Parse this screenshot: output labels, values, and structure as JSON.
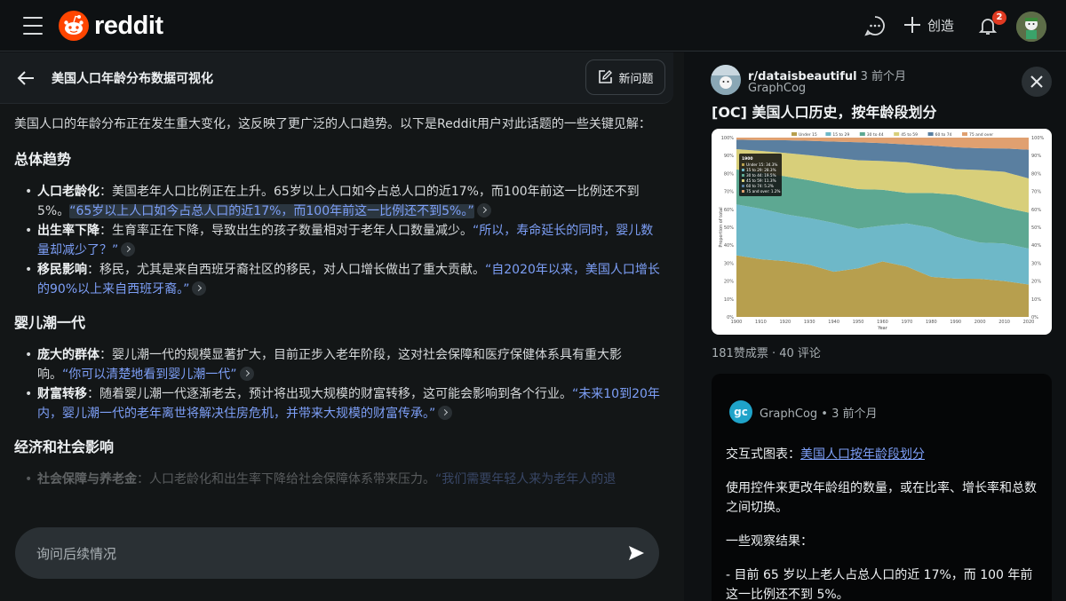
{
  "header": {
    "logo_text": "reddit",
    "create_label": "创造",
    "notification_count": "2",
    "icons": [
      "menu-icon",
      "reddit-logo-icon",
      "chat-icon",
      "plus-icon",
      "bell-icon",
      "avatar"
    ]
  },
  "left_panel": {
    "title": "美国人口年龄分布数据可视化",
    "new_question_label": "新问题",
    "intro": "美国人口的年龄分布正在发生重大变化，这反映了更广泛的人口趋势。以下是Reddit用户对此话题的一些关键见解：",
    "sections": [
      {
        "heading": "总体趋势",
        "items": [
          {
            "term": "人口老龄化",
            "text": "：美国老年人口比例正在上升。65岁以上人口如今占总人口的近17%，而100年前这一比例还不到5%。",
            "quote": "“65岁以上人口如今占总人口的近17%，而100年前这一比例还不到5%。”"
          },
          {
            "term": "出生率下降",
            "text": "：生育率正在下降，导致出生的孩子数量相对于老年人口数量减少。",
            "quote": "“所以，寿命延长的同时，婴儿数量却减少了？”"
          },
          {
            "term": "移民影响",
            "text": "：移民，尤其是来自西班牙裔社区的移民，对人口增长做出了重大贡献。",
            "quote": "“自2020年以来，美国人口增长的90%以上来自西班牙裔。”"
          }
        ]
      },
      {
        "heading": "婴儿潮一代",
        "items": [
          {
            "term": "庞大的群体",
            "text": "：婴儿潮一代的规模显著扩大，目前正步入老年阶段，这对社会保障和医疗保健体系具有重大影响。",
            "quote": "“你可以清楚地看到婴儿潮一代”"
          },
          {
            "term": "财富转移",
            "text": "：随着婴儿潮一代逐渐老去，预计将出现大规模的财富转移，这可能会影响到各个行业。",
            "quote": "“未来10到20年内，婴儿潮一代的老年离世将解决住房危机，并带来大规模的财富传承。”"
          }
        ]
      },
      {
        "heading": "经济和社会影响",
        "items": [
          {
            "term": "社会保障与养老金",
            "text": "：人口老龄化和出生率下降给社会保障体系带来压力。",
            "quote": "“我们需要年轻人来为老年人的退"
          }
        ]
      }
    ],
    "follow_up_placeholder": "询问后续情况"
  },
  "right_panel": {
    "subreddit": "r/dataisbeautiful",
    "post_time": "3 前个月",
    "author": "GraphCog",
    "post_title": "[OC] 美国人口历史，按年龄段划分",
    "stats": "181赞成票 · 40 评论",
    "comment": {
      "logo_text": "gc",
      "author": "GraphCog",
      "time": "3 前个月",
      "p1_prefix": "交互式图表：",
      "p1_link": "美国人口按年龄段划分",
      "p2": "使用控件来更改年龄组的数量，或在比率、增长率和总数之间切换。",
      "p3": "一些观察结果：",
      "p4": "- 目前 65 岁以上老人占总人口的近 17%，而 100 年前这一比例还不到 5%。"
    }
  },
  "chart_data": {
    "type": "area",
    "stacked": true,
    "xlabel": "Year",
    "ylabel": "Proportion of total",
    "x": [
      1900,
      1910,
      1920,
      1930,
      1940,
      1950,
      1960,
      1970,
      1980,
      1990,
      2000,
      2010,
      2020
    ],
    "ylim": [
      0,
      100
    ],
    "y_ticks": [
      "0%",
      "10%",
      "20%",
      "30%",
      "40%",
      "50%",
      "60%",
      "70%",
      "80%",
      "90%",
      "100%"
    ],
    "legend_position": "top",
    "series": [
      {
        "name": "Under 15",
        "color": "#b79f4e",
        "values": [
          34.3,
          32,
          31,
          29,
          25,
          27,
          31,
          28,
          22,
          21,
          21,
          20,
          18
        ]
      },
      {
        "name": "15 to 29",
        "color": "#6eb8c8",
        "values": [
          28.3,
          28,
          26,
          26,
          27,
          22,
          20,
          24,
          27,
          23,
          20,
          21,
          20
        ]
      },
      {
        "name": "30 to 44",
        "color": "#5da892",
        "values": [
          19.5,
          20,
          21,
          21,
          21,
          22,
          20,
          17,
          19,
          23,
          23,
          20,
          20
        ]
      },
      {
        "name": "45 to 59",
        "color": "#d8cf7a",
        "values": [
          11.3,
          12,
          13,
          14,
          15,
          16,
          16,
          17,
          15,
          14,
          17,
          20,
          19
        ]
      },
      {
        "name": "60 to 74",
        "color": "#5a7fa0",
        "values": [
          5.2,
          6,
          7,
          8,
          9,
          10,
          10,
          10,
          11,
          12,
          12,
          13,
          16
        ]
      },
      {
        "name": "75 and over",
        "color": "#e0a070",
        "values": [
          1.2,
          1.4,
          1.5,
          1.8,
          2.2,
          2.6,
          3.1,
          3.8,
          4.4,
          5.3,
          5.9,
          6.1,
          6.7
        ]
      }
    ],
    "tooltip": {
      "year": "1900",
      "lines": [
        "Under 15: 34.3%",
        "15 to 29: 28.3%",
        "30 to 44: 19.5%",
        "45 to 59: 11.3%",
        "60 to 74: 5.2%",
        "75 and over: 1.2%"
      ]
    }
  }
}
